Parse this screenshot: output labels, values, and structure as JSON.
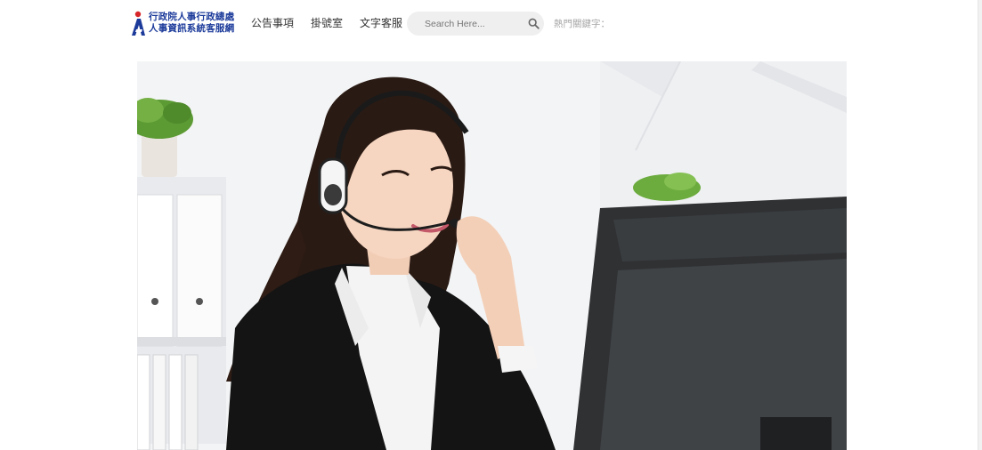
{
  "header": {
    "logo": {
      "line1": "行政院人事行政總處",
      "line2": "人事資訊系統客服網"
    },
    "nav": [
      {
        "label": "公告事項"
      },
      {
        "label": "掛號室"
      },
      {
        "label": "文字客服"
      }
    ],
    "search": {
      "placeholder": "Search Here...",
      "icon": "search-icon"
    },
    "hot_keywords_label": "熱門關鍵字："
  },
  "hero": {
    "alt": "customer service agent with headset at computer",
    "icon": "hero-photo"
  },
  "colors": {
    "brand_blue": "#1b3a9a",
    "brand_red": "#d7262a",
    "nav_text": "#333333",
    "search_bg": "#efefef"
  }
}
